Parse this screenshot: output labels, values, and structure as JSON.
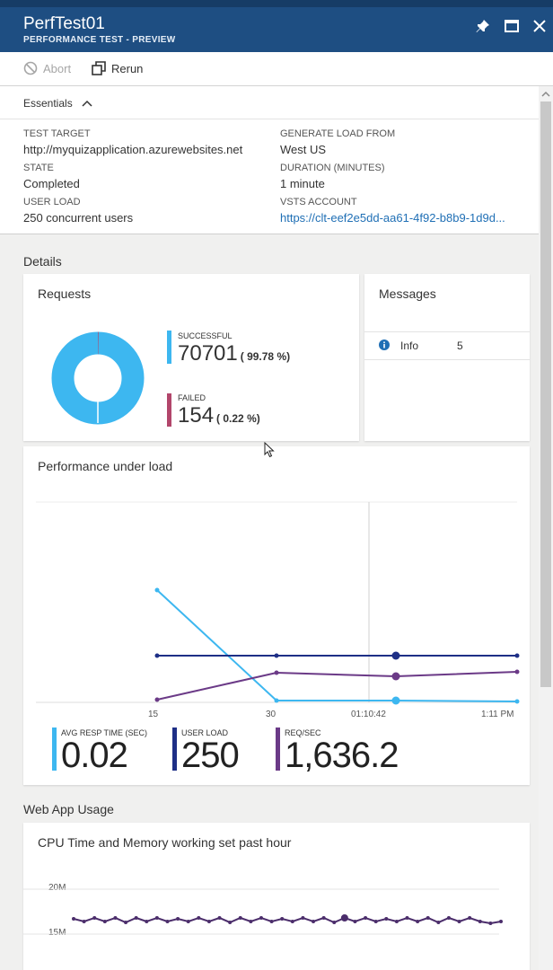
{
  "window": {
    "title": "PerfTest01",
    "subtitle": "PERFORMANCE TEST - PREVIEW"
  },
  "toolbar": {
    "abort_label": "Abort",
    "rerun_label": "Rerun"
  },
  "essentials": {
    "header": "Essentials",
    "test_target_label": "TEST TARGET",
    "test_target_value": "http://myquizapplication.azurewebsites.net",
    "state_label": "STATE",
    "state_value": "Completed",
    "user_load_label": "USER LOAD",
    "user_load_value": "250 concurrent users",
    "generate_label": "GENERATE LOAD FROM",
    "generate_value": "West US",
    "duration_label": "DURATION (MINUTES)",
    "duration_value": "1 minute",
    "vsts_label": "VSTS ACCOUNT",
    "vsts_value": "https://clt-eef2e5dd-aa61-4f92-b8b9-1d9d..."
  },
  "details": {
    "title": "Details",
    "requests": {
      "title": "Requests",
      "successful_label": "SUCCESSFUL",
      "successful_value": "70701",
      "successful_pct": "( 99.78 %)",
      "failed_label": "FAILED",
      "failed_value": "154",
      "failed_pct": "( 0.22 %)",
      "successful_fraction": 0.9978
    },
    "messages": {
      "title": "Messages",
      "items": [
        {
          "type": "Info",
          "count": "5"
        }
      ]
    }
  },
  "performance": {
    "title": "Performance under load",
    "x_ticks": [
      "15",
      "30",
      "01:10:42",
      "1:11 PM"
    ],
    "metrics": [
      {
        "label": "AVG RESP TIME (SEC)",
        "value": "0.02",
        "color": "#3db7f0"
      },
      {
        "label": "USER LOAD",
        "value": "250",
        "color": "#1e2f86"
      },
      {
        "label": "REQ/SEC",
        "value": "1,636.2",
        "color": "#6b3a87"
      }
    ]
  },
  "web_app": {
    "title": "Web App Usage",
    "cpu_title": "CPU Time and Memory working set past hour",
    "y_ticks": [
      "20M",
      "15M"
    ]
  },
  "colors": {
    "titlebar": "#1e4e82",
    "successful": "#3db7f0",
    "failed": "#b2466b",
    "user_load": "#1e2f86",
    "req_sec": "#6b3a87",
    "link": "#1f6fb5"
  }
}
